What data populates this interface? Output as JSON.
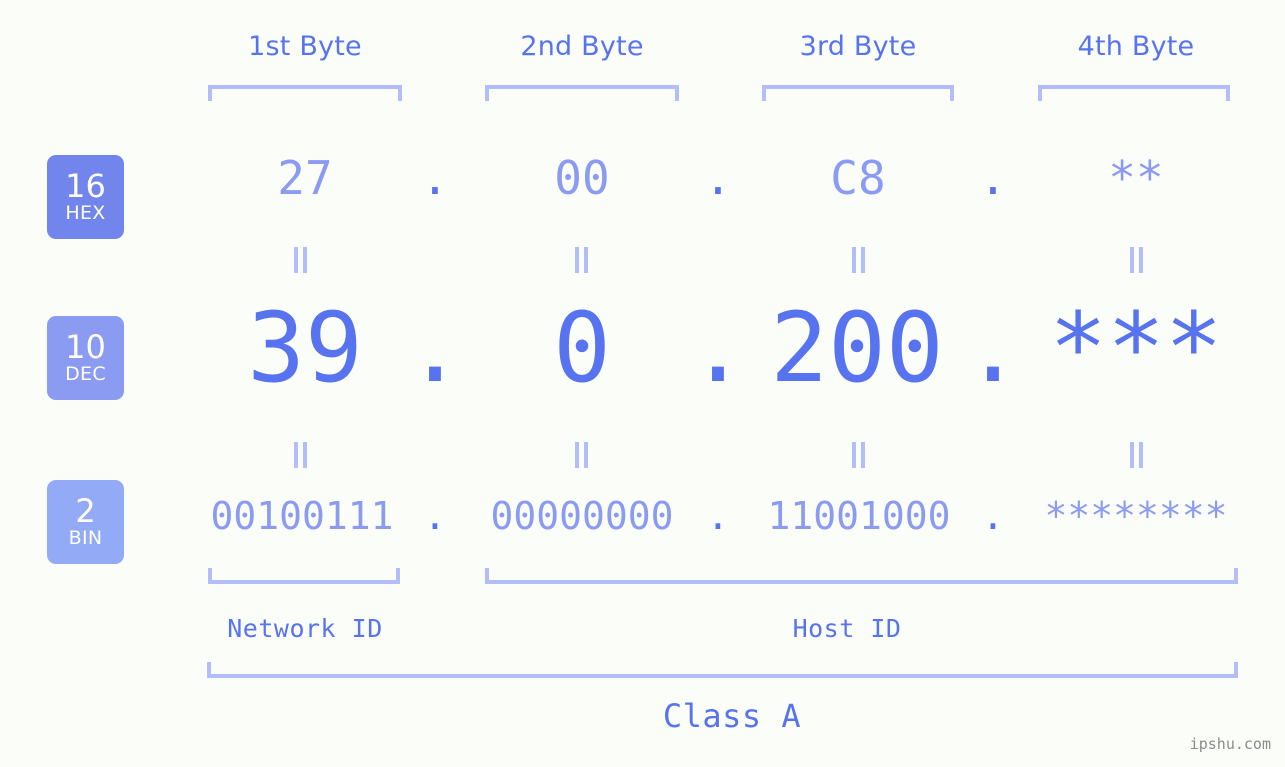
{
  "page": {
    "background_color": "#fbfdf9",
    "accent_color": "#5773ef",
    "accent_light_color": "#8b9bf1",
    "bracket_color": "#b3bdfa",
    "watermark": "ipshu.com"
  },
  "headers": [
    {
      "label": "1st Byte"
    },
    {
      "label": "2nd Byte"
    },
    {
      "label": "3rd Byte"
    },
    {
      "label": "4th Byte"
    }
  ],
  "radix_badges": [
    {
      "number": "16",
      "name": "HEX",
      "color": "#7185ec"
    },
    {
      "number": "10",
      "name": "DEC",
      "color": "#8b9bf1"
    },
    {
      "number": "2",
      "name": "BIN",
      "color": "#93aaf6"
    }
  ],
  "rows": {
    "hex": {
      "radix": "16",
      "radix_name": "HEX",
      "bytes": [
        "27",
        "00",
        "C8",
        "**"
      ],
      "separators": [
        ".",
        ".",
        "."
      ]
    },
    "dec": {
      "radix": "10",
      "radix_name": "DEC",
      "bytes": [
        "39",
        "0",
        "200",
        "***"
      ],
      "separators": [
        ".",
        ".",
        "."
      ]
    },
    "bin": {
      "radix": "2",
      "radix_name": "BIN",
      "bytes": [
        "00100111",
        "00000000",
        "11001000",
        "********"
      ],
      "separators": [
        ".",
        ".",
        "."
      ]
    }
  },
  "equals_connectors": {
    "glyph": "=",
    "count_per_gap": 4
  },
  "sections": [
    {
      "label": "Network ID"
    },
    {
      "label": "Host ID"
    }
  ],
  "class": {
    "label": "Class A"
  }
}
